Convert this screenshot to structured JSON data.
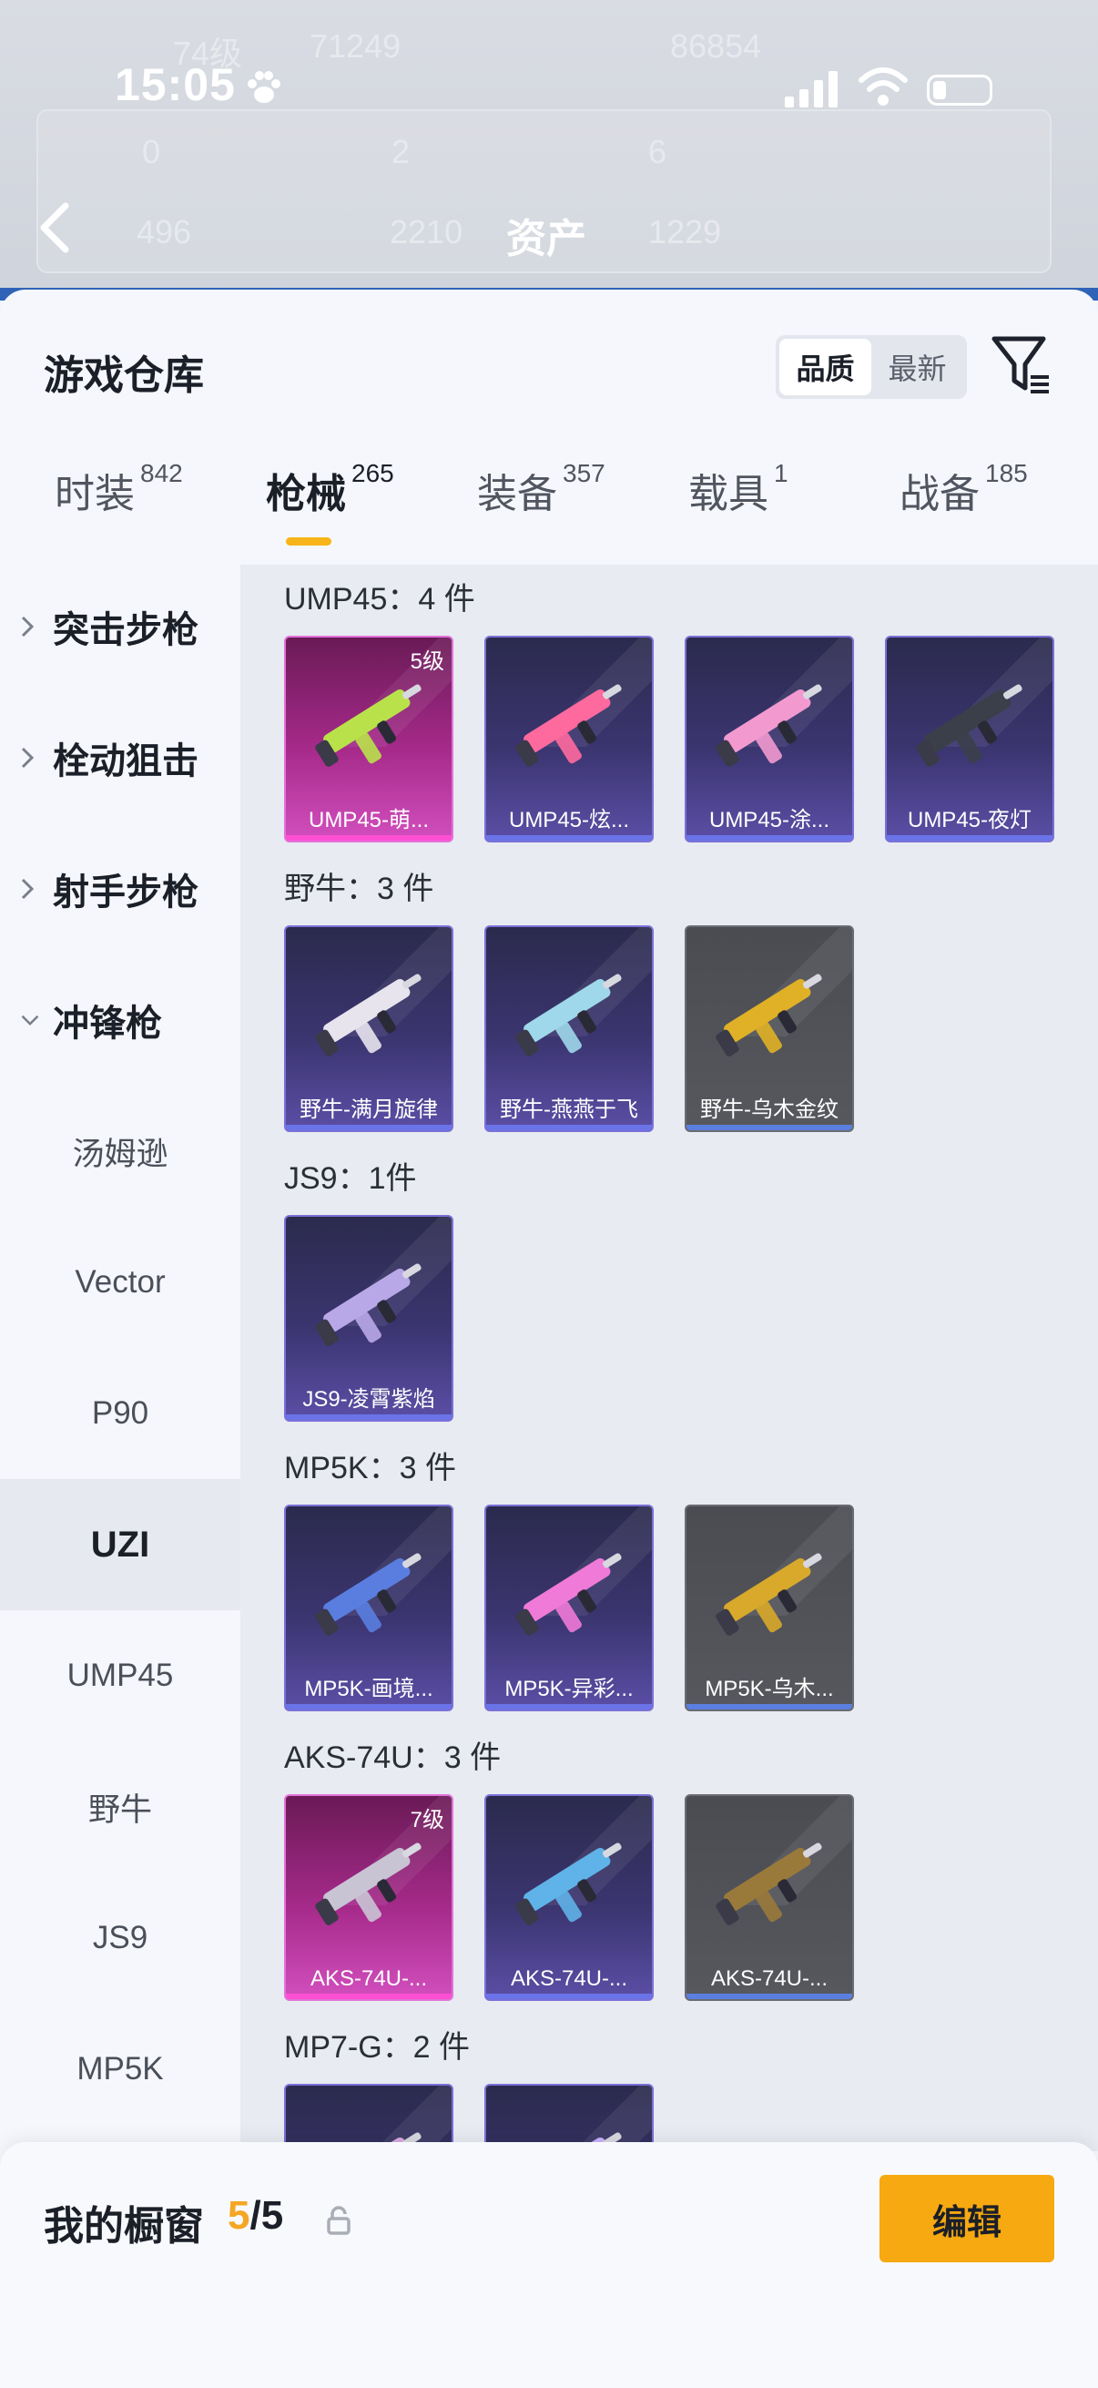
{
  "status_bar": {
    "time": "15:05"
  },
  "backdrop": {
    "title": "资产",
    "faded_stats": [
      "74级",
      "71249",
      "86854",
      "0",
      "2",
      "6",
      "496",
      "2210",
      "1229"
    ]
  },
  "header": {
    "title": "游戏仓库",
    "sort_options": [
      {
        "label": "品质",
        "active": true
      },
      {
        "label": "最新",
        "active": false
      }
    ]
  },
  "tabs": [
    {
      "label": "时装",
      "count": "842",
      "active": false
    },
    {
      "label": "枪械",
      "count": "265",
      "active": true
    },
    {
      "label": "装备",
      "count": "357",
      "active": false
    },
    {
      "label": "载具",
      "count": "1",
      "active": false
    },
    {
      "label": "战备",
      "count": "185",
      "active": false
    }
  ],
  "rail": {
    "categories": [
      {
        "label": "突击步枪",
        "expanded": false
      },
      {
        "label": "栓动狙击",
        "expanded": false
      },
      {
        "label": "射手步枪",
        "expanded": false
      },
      {
        "label": "冲锋枪",
        "expanded": true
      }
    ],
    "subitems": [
      "汤姆逊",
      "Vector",
      "P90",
      "UZI",
      "UMP45",
      "野牛",
      "JS9",
      "MP5K"
    ],
    "selected": "UZI"
  },
  "groups": [
    {
      "title": "UMP45：4 件",
      "items": [
        {
          "name": "UMP45-萌...",
          "rarity": "gold",
          "level": "5级"
        },
        {
          "name": "UMP45-炫...",
          "rarity": "purple"
        },
        {
          "name": "UMP45-涂...",
          "rarity": "purple"
        },
        {
          "name": "UMP45-夜灯",
          "rarity": "purple"
        }
      ]
    },
    {
      "title": "野牛：3 件",
      "items": [
        {
          "name": "野牛-满月旋律",
          "rarity": "purple"
        },
        {
          "name": "野牛-燕燕于飞",
          "rarity": "purple"
        },
        {
          "name": "野牛-乌木金纹",
          "rarity": "gray"
        }
      ]
    },
    {
      "title": "JS9：1件",
      "items": [
        {
          "name": "JS9-凌霄紫焰",
          "rarity": "purple"
        }
      ]
    },
    {
      "title": "MP5K：3 件",
      "items": [
        {
          "name": "MP5K-画境...",
          "rarity": "purple"
        },
        {
          "name": "MP5K-异彩...",
          "rarity": "purple"
        },
        {
          "name": "MP5K-乌木...",
          "rarity": "gray"
        }
      ]
    },
    {
      "title": "AKS-74U：3 件",
      "items": [
        {
          "name": "AKS-74U-...",
          "rarity": "gold",
          "level": "7级"
        },
        {
          "name": "AKS-74U-...",
          "rarity": "purple"
        },
        {
          "name": "AKS-74U-...",
          "rarity": "gray"
        }
      ]
    },
    {
      "title": "MP7-G：2 件",
      "items": [
        {
          "name": "",
          "rarity": "purple"
        },
        {
          "name": "",
          "rarity": "purple"
        }
      ]
    }
  ],
  "showcase": {
    "label": "我的橱窗",
    "current": "5",
    "separator": "/",
    "total": "5",
    "edit_label": "编辑"
  },
  "colors": {
    "accent": "#f7a911",
    "rarity_gold": "#d24fbe",
    "rarity_purple": "#5b4ea6",
    "rarity_gray": "#56585e"
  }
}
